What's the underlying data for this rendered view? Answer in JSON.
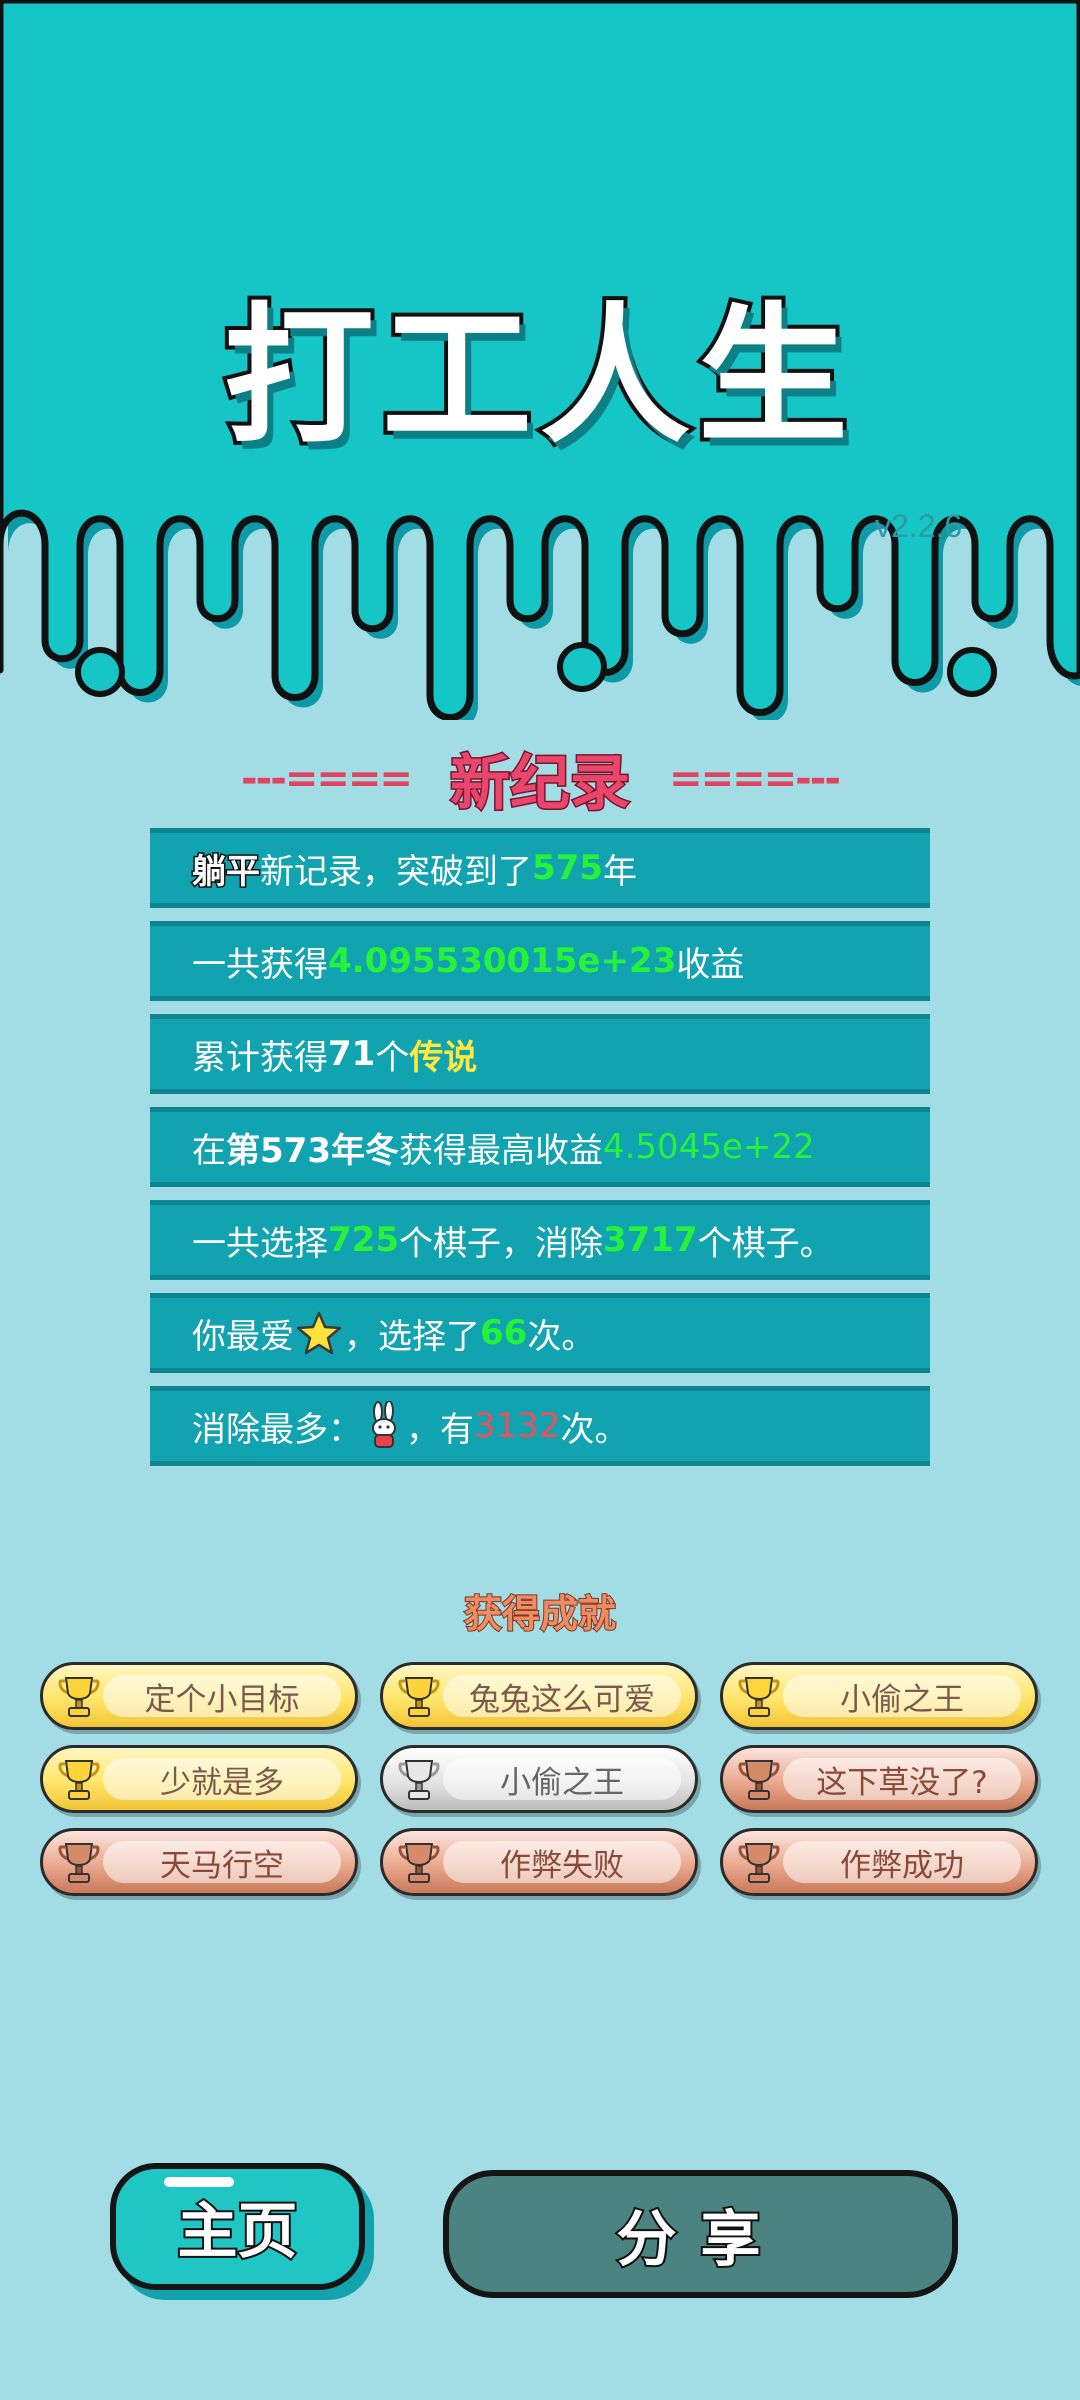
{
  "app": {
    "title": "打工人生",
    "version": "v2.2.6"
  },
  "record": {
    "header": "新纪录",
    "dash_left": "---====",
    "dash_right": "====---",
    "rows": [
      {
        "segments": [
          {
            "text": "躺平",
            "style": "outline"
          },
          {
            "text": "新记录，突破到了",
            "style": "plain"
          },
          {
            "text": "575",
            "style": "green"
          },
          {
            "text": "年",
            "style": "plain"
          }
        ]
      },
      {
        "segments": [
          {
            "text": "一共获得",
            "style": "plain"
          },
          {
            "text": "4.095530015e+23",
            "style": "green"
          },
          {
            "text": "收益",
            "style": "plain"
          }
        ]
      },
      {
        "segments": [
          {
            "text": "累计获得",
            "style": "plain"
          },
          {
            "text": "71",
            "style": "white"
          },
          {
            "text": "个 ",
            "style": "plain"
          },
          {
            "text": "传说",
            "style": "yellow"
          }
        ]
      },
      {
        "segments": [
          {
            "text": "在 ",
            "style": "plain"
          },
          {
            "text": "第573年冬",
            "style": "white"
          },
          {
            "text": " 获得最高收益",
            "style": "plain"
          },
          {
            "text": "4.5045e+22",
            "style": "thin-green"
          }
        ]
      },
      {
        "segments": [
          {
            "text": "一共选择",
            "style": "plain"
          },
          {
            "text": "725",
            "style": "green"
          },
          {
            "text": "个棋子，消除",
            "style": "plain"
          },
          {
            "text": "3717",
            "style": "green"
          },
          {
            "text": "个棋子。",
            "style": "plain"
          }
        ]
      },
      {
        "segments": [
          {
            "text": "你最爱",
            "style": "plain"
          },
          {
            "icon": "star-icon"
          },
          {
            "text": "，选择了",
            "style": "plain"
          },
          {
            "text": "66",
            "style": "green"
          },
          {
            "text": "次。",
            "style": "plain"
          }
        ]
      },
      {
        "segments": [
          {
            "text": "消除最多：",
            "style": "plain"
          },
          {
            "icon": "rabbit-icon"
          },
          {
            "text": "，有",
            "style": "plain"
          },
          {
            "text": "3132",
            "style": "red"
          },
          {
            "text": "次。",
            "style": "plain"
          }
        ]
      }
    ]
  },
  "achievements": {
    "header": "获得成就",
    "items": [
      {
        "label": "定个小目标",
        "tier": "gold"
      },
      {
        "label": "兔兔这么可爱",
        "tier": "gold"
      },
      {
        "label": "小偷之王",
        "tier": "gold"
      },
      {
        "label": "少就是多",
        "tier": "gold"
      },
      {
        "label": "小偷之王",
        "tier": "silver"
      },
      {
        "label": "这下草没了?",
        "tier": "bronze"
      },
      {
        "label": "天马行空",
        "tier": "bronze"
      },
      {
        "label": "作弊失败",
        "tier": "bronze"
      },
      {
        "label": "作弊成功",
        "tier": "bronze"
      }
    ]
  },
  "buttons": {
    "home": "主页",
    "share": "分享"
  },
  "colors": {
    "top_band": "#16c6c6",
    "background": "#a2dde6",
    "row_bg": "#12a3b1",
    "highlight_green": "#27f23a",
    "highlight_red": "#ef4e5c",
    "highlight_yellow": "#ffe93a"
  }
}
